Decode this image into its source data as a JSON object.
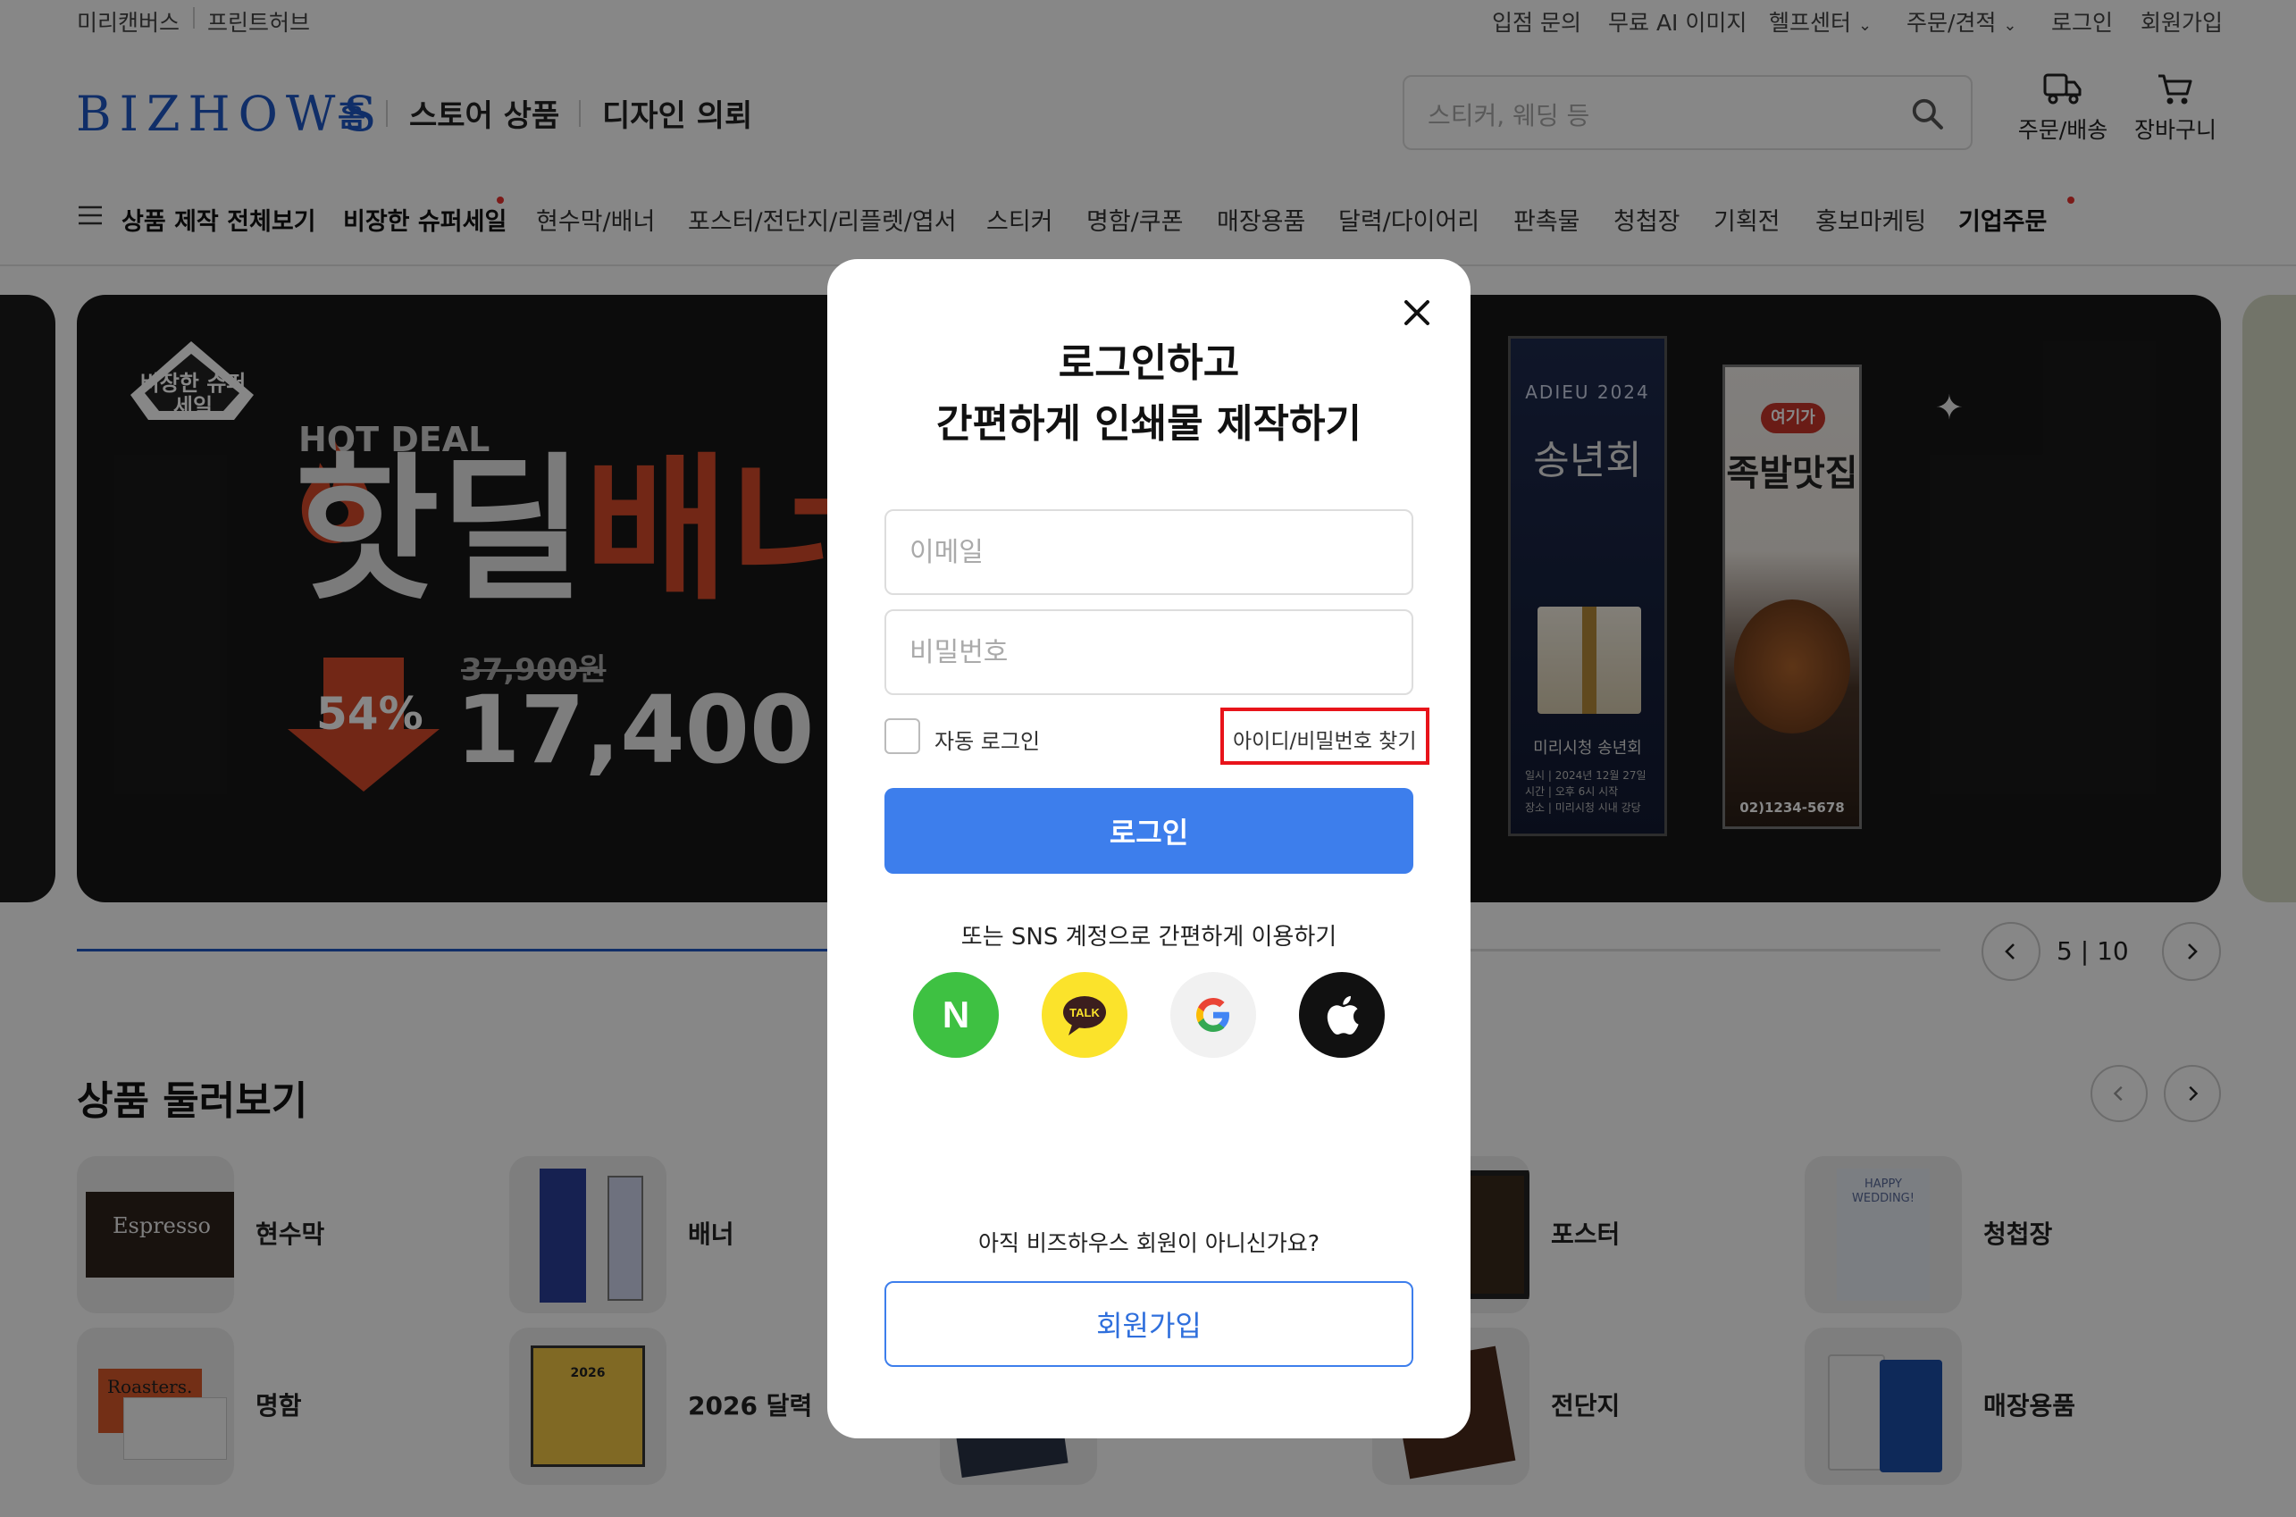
{
  "topbar": {
    "left_links": [
      "미리캔버스",
      "프린트허브"
    ],
    "right_links": [
      "입점 문의",
      "무료 AI 이미지",
      "헬프센터",
      "주문/견적",
      "로그인",
      "회원가입"
    ]
  },
  "header": {
    "logo": "BIZHOWS",
    "nav": [
      "홈",
      "스토어 상품",
      "디자인 의뢰"
    ],
    "search_placeholder": "스티커, 웨딩 등",
    "utilities": [
      "주문/배송",
      "장바구니"
    ]
  },
  "category_nav": {
    "all": "상품 제작 전체보기",
    "items": [
      "비장한 슈퍼세일",
      "현수막/배너",
      "포스터/전단지/리플렛/엽서",
      "스티커",
      "명함/쿠폰",
      "매장용품",
      "달력/다이어리",
      "판촉물",
      "청첩장",
      "기획전",
      "홍보마케팅",
      "기업주문"
    ]
  },
  "hero": {
    "badge": "비장한 슈퍼세일",
    "hot_deal": "HOT DEAL",
    "headline_white": "핫딜",
    "headline_red": "배너",
    "discount": "54%",
    "original_price": "37,900원",
    "sale_price": "17,400",
    "banner1": {
      "top": "ADIEU 2024",
      "title": "송년회",
      "sub": "미리시청 송년회",
      "lines": [
        "일시 | 2024년 12월 27일",
        "시간 | 오후 6시 시작",
        "장소 | 미리시청 시내 강당"
      ]
    },
    "banner2": {
      "tag": "여기가",
      "title": "족발맛집",
      "phone": "02)1234-5678"
    },
    "page_current": "5",
    "page_total": "10"
  },
  "products": {
    "title": "상품 둘러보기",
    "items": [
      "현수막",
      "배너",
      "포스터",
      "청첩장",
      "명함",
      "2026 달력",
      "전단지",
      "매장용품"
    ],
    "thumb_texts": {
      "espresso": "Espresso",
      "roasters": "Roasters.",
      "calendar_year": "2026",
      "wedding": "HAPPY WEDDING!"
    }
  },
  "modal": {
    "title_line1": "로그인하고",
    "title_line2": "간편하게 인쇄물 제작하기",
    "email_placeholder": "이메일",
    "password_placeholder": "비밀번호",
    "auto_login": "자동 로그인",
    "find_account": "아이디/비밀번호 찾기",
    "login_button": "로그인",
    "sns_text": "또는 SNS 계정으로 간편하게 이용하기",
    "sns": [
      "N",
      "TALK",
      "G",
      "apple"
    ],
    "signup_prompt": "아직 비즈하우스 회원이 아니신가요?",
    "signup_button": "회원가입",
    "highlight_color": "#e8131a"
  },
  "colors": {
    "brand": "#1f58c4",
    "login_button": "#3d7eec",
    "naver": "#3ec142",
    "kakao": "#fbe32b",
    "hero_red": "#d84a2a"
  }
}
